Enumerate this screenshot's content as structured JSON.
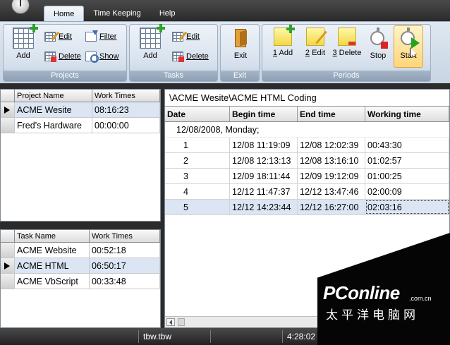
{
  "tabs": [
    "Home",
    "Time Keeping",
    "Help"
  ],
  "ribbon": {
    "projects": {
      "label": "Projects",
      "add": "Add",
      "edit": "Edit",
      "delete": "Delete",
      "filter": "Filter",
      "show": "Show"
    },
    "tasks": {
      "label": "Tasks",
      "add": "Add",
      "edit": "Edit",
      "delete": "Delete"
    },
    "exit": {
      "label": "Exit",
      "button": "Exit"
    },
    "periods": {
      "label": "Periods",
      "add_key": "1",
      "add": " Add",
      "edit_key": "2",
      "edit": " Edit",
      "delete_key": "3",
      "delete": " Delete",
      "stop": "Stop",
      "start": "Start"
    }
  },
  "projects_grid": {
    "columns": [
      "Project Name",
      "Work Times"
    ],
    "rows": [
      {
        "name": "ACME Wesite",
        "time": "08:16:23"
      },
      {
        "name": "Fred's Hardware",
        "time": "00:00:00"
      }
    ]
  },
  "tasks_grid": {
    "columns": [
      "Task Name",
      "Work Times"
    ],
    "rows": [
      {
        "name": "ACME Website",
        "time": "00:52:18"
      },
      {
        "name": "ACME HTML",
        "time": "06:50:17"
      },
      {
        "name": "ACME VbScript",
        "time": "00:33:48"
      }
    ]
  },
  "periods": {
    "path": "\\ACME Wesite\\ACME HTML Coding",
    "columns": [
      "Date",
      "Begin time",
      "End time",
      "Working time"
    ],
    "group": "12/08/2008, Monday;",
    "rows": [
      {
        "n": "1",
        "begin": "12/08 11:19:09",
        "end": "12/08 12:02:39",
        "work": "00:43:30"
      },
      {
        "n": "2",
        "begin": "12/08 12:13:13",
        "end": "12/08 13:16:10",
        "work": "01:02:57"
      },
      {
        "n": "3",
        "begin": "12/09 18:11:44",
        "end": "12/09 19:12:09",
        "work": "01:00:25"
      },
      {
        "n": "4",
        "begin": "12/12 11:47:37",
        "end": "12/12 13:47:46",
        "work": "02:00:09"
      },
      {
        "n": "5",
        "begin": "12/12 14:23:44",
        "end": "12/12 16:27:00",
        "work": "02:03:16"
      }
    ]
  },
  "status": {
    "file": "tbw.tbw",
    "clock": "4:28:02 P"
  },
  "watermark": {
    "logo": "PConline",
    "domain": ".com.cn",
    "cn": "太平洋电脑网"
  }
}
